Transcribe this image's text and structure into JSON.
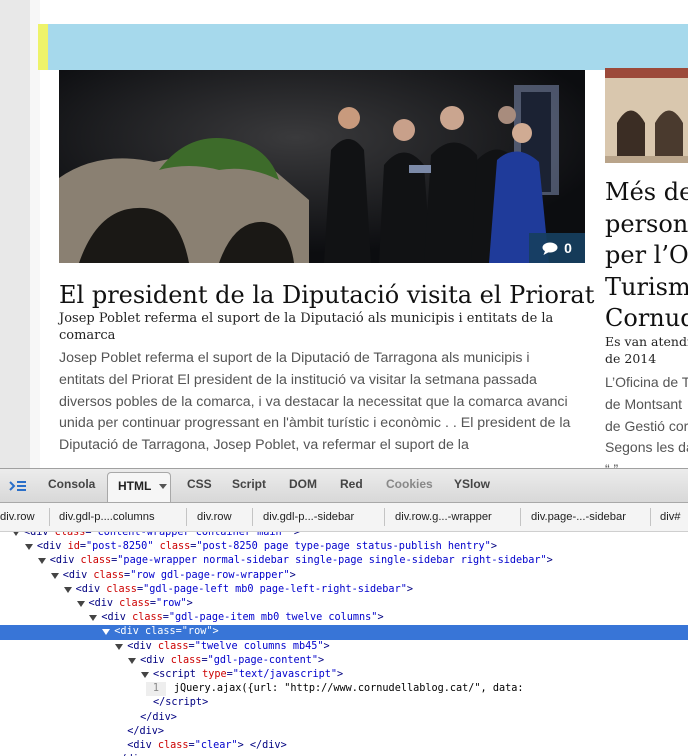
{
  "article": {
    "title": "El president de la Diputació visita el Priorat",
    "subtitle": "Josep Poblet referma el suport de la Diputació als municipis i entitats de la comarca",
    "excerpt": "Josep Poblet referma el suport de la Diputació de Tarragona als municipis i entitats del Priorat El president de la institució va visitar la setmana passada diversos pobles de la comarca, i va destacar la necessitat que la comarca avanci unida per continuar progressant en l'àmbit turístic i econòmic . . El president de la Diputació de Tarragona, Josep Poblet, va refermar el suport de la",
    "comment_count": "0"
  },
  "sidebar_post": {
    "title_lines": [
      "Més de",
      "persone",
      "per l’Of",
      "Turism",
      "Cornud"
    ],
    "meta_lines": [
      "Es van atendr",
      "de 2014"
    ],
    "excerpt_lines": [
      "L’Oficina de T",
      "de Montsant",
      "de Gestió cor",
      "Segons les da",
      "“ ”"
    ]
  },
  "firebug": {
    "tabs": [
      "Consola",
      "HTML",
      "CSS",
      "Script",
      "DOM",
      "Red",
      "Cookies",
      "YSlow"
    ],
    "active_tab": "HTML",
    "breadcrumbs": [
      "div.row",
      "div.gdl-p....columns",
      "div.row",
      "div.gdl-p...-sidebar",
      "div.row.g...-wrapper",
      "div.page-...-sidebar",
      "div#"
    ],
    "tree": [
      {
        "indent": 0,
        "tag": "div",
        "attrs": [
          [
            "class",
            "content-wrapper container main "
          ]
        ],
        "close": false
      },
      {
        "indent": 1,
        "tag": "div",
        "attrs": [
          [
            "id",
            "post-8250"
          ],
          [
            "class",
            "post-8250 page type-page status-publish hentry"
          ]
        ],
        "close": false
      },
      {
        "indent": 2,
        "tag": "div",
        "attrs": [
          [
            "class",
            "page-wrapper normal-sidebar single-page single-sidebar right-sidebar"
          ]
        ],
        "close": false
      },
      {
        "indent": 3,
        "tag": "div",
        "attrs": [
          [
            "class",
            "row gdl-page-row-wrapper"
          ]
        ],
        "close": false
      },
      {
        "indent": 4,
        "tag": "div",
        "attrs": [
          [
            "class",
            "gdl-page-left mb0 page-left-right-sidebar"
          ]
        ],
        "close": false
      },
      {
        "indent": 5,
        "tag": "div",
        "attrs": [
          [
            "class",
            "row"
          ]
        ],
        "close": false
      },
      {
        "indent": 6,
        "tag": "div",
        "attrs": [
          [
            "class",
            "gdl-page-item mb0 twelve columns"
          ]
        ],
        "close": false
      },
      {
        "indent": 7,
        "tag": "div",
        "attrs": [
          [
            "class",
            "row"
          ]
        ],
        "close": false,
        "selected": true
      },
      {
        "indent": 8,
        "tag": "div",
        "attrs": [
          [
            "class",
            "twelve columns mb45"
          ]
        ],
        "close": false
      },
      {
        "indent": 9,
        "tag": "div",
        "attrs": [
          [
            "class",
            "gdl-page-content"
          ]
        ],
        "close": false
      },
      {
        "indent": 10,
        "tag": "script",
        "attrs": [
          [
            "type",
            "text/javascript"
          ]
        ],
        "close": false
      },
      {
        "indent": 11,
        "code": "jQuery.ajax({url: \"http://www.cornudellablog.cat/\", data:",
        "lineno": "1"
      },
      {
        "indent": 10,
        "end": "script"
      },
      {
        "indent": 9,
        "end": "div"
      },
      {
        "indent": 8,
        "end": "div"
      },
      {
        "indent": 8,
        "tag": "div",
        "attrs": [
          [
            "class",
            "clear"
          ]
        ],
        "close": true
      },
      {
        "indent": 7,
        "end": "div"
      }
    ]
  },
  "colors": {
    "banner": "#a6d9ec",
    "banner_accent": "#eef36a",
    "selection": "#3875d7",
    "comment_badge": "#173f5f"
  }
}
